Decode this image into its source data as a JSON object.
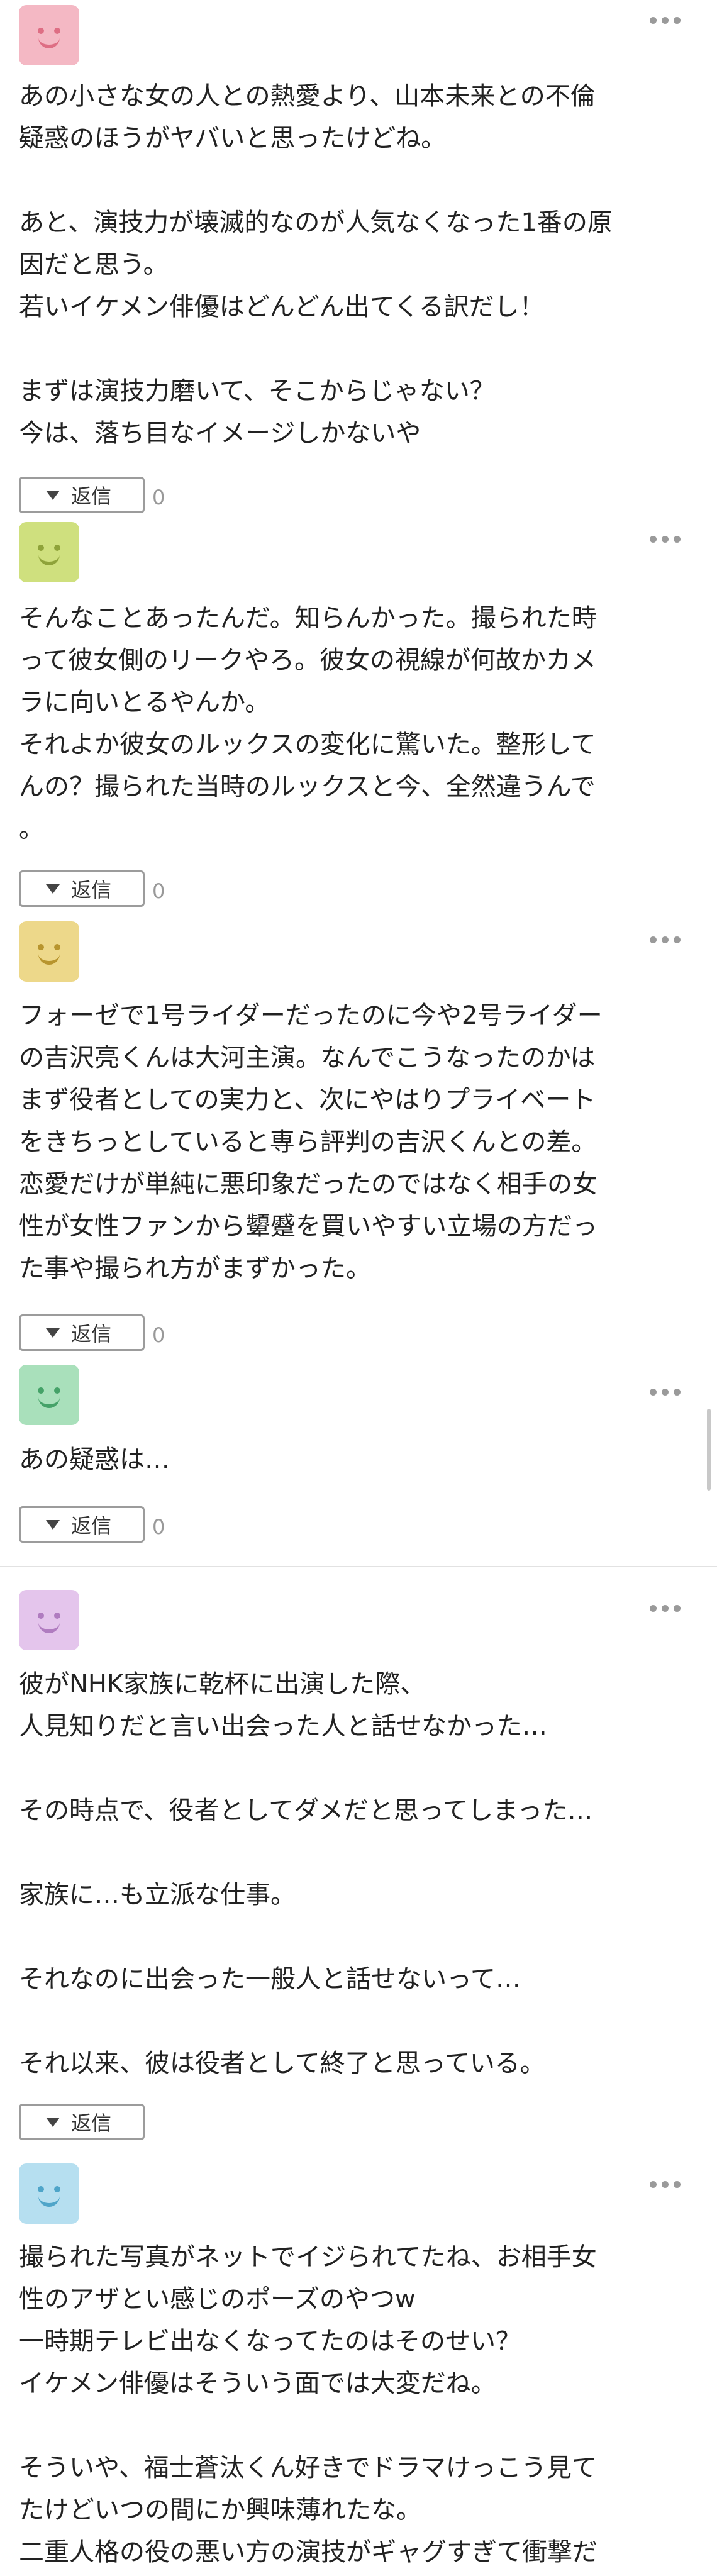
{
  "comments": [
    {
      "avatar_color": "#f4b8c4",
      "face_color": "#de6e84",
      "text": "あの小さな女の人との熱愛より、山本未来との不倫\n疑惑のほうがヤバいと思ったけどね。\n\nあと、演技力が壊滅的なのが人気なくなった1番の原\n因だと思う。\n若いイケメン俳優はどんどん出てくる訳だし！\n\nまずは演技力磨いて、そこからじゃない？\n今は、落ち目なイメージしかないや",
      "reply_label": "返信",
      "reply_count": "0"
    },
    {
      "avatar_color": "#cfe07e",
      "face_color": "#8fa33a",
      "text": "そんなことあったんだ。知らんかった。撮られた時\nって彼女側のリークやろ。彼女の視線が何故かカメ\nラに向いとるやんか。\nそれよか彼女のルックスの変化に驚いた。整形して\nんの？撮られた当時のルックスと今、全然違うんで\n。",
      "reply_label": "返信",
      "reply_count": "0"
    },
    {
      "avatar_color": "#edd88a",
      "face_color": "#b8952e",
      "text": "フォーゼで1号ライダーだったのに今や2号ライダー\nの吉沢亮くんは大河主演。なんでこうなったのかは\nまず役者としての実力と、次にやはりプライベート\nをきちっとしていると専ら評判の吉沢くんとの差。\n恋愛だけが単純に悪印象だったのではなく相手の女\n性が女性ファンから顰蹙を買いやすい立場の方だっ\nた事や撮られ方がまずかった。",
      "reply_label": "返信",
      "reply_count": "0"
    },
    {
      "avatar_color": "#a9e0bb",
      "face_color": "#45a268",
      "text": "あの疑惑は…",
      "reply_label": "返信",
      "reply_count": "0"
    },
    {
      "avatar_color": "#e4c5ec",
      "face_color": "#b07cc0",
      "text": "彼がNHK家族に乾杯に出演した際、\n人見知りだと言い出会った人と話せなかった…\n\nその時点で、役者としてダメだと思ってしまった…\n\n家族に…も立派な仕事。\n\nそれなのに出会った一般人と話せないって…\n\nそれ以来、彼は役者として終了と思っている。",
      "reply_label": "返信",
      "reply_count": ""
    },
    {
      "avatar_color": "#b6dff0",
      "face_color": "#4fa5c9",
      "text": "撮られた写真がネットでイジられてたね、お相手女\n性のアザとい感じのポーズのやつw\n一時期テレビ出なくなってたのはそのせい？\nイケメン俳優はそういう面では大変だね。\n\nそういや、福士蒼汰くん好きでドラマけっこう見て\nたけどいつの間にか興味薄れたな。\n二重人格の役の悪い方の演技がギャグすぎて衝撃だ"
    }
  ]
}
